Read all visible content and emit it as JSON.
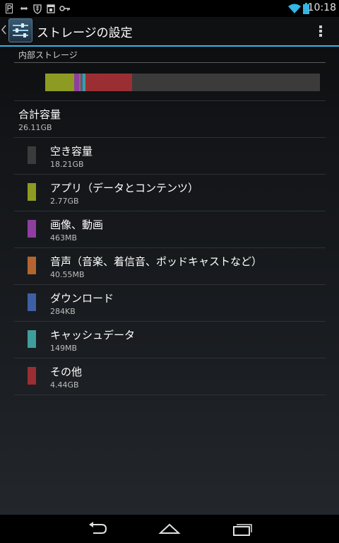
{
  "status_bar": {
    "time": "10:18",
    "left_icons": [
      "parking-icon",
      "usb-icon",
      "shield-icon",
      "calendar-icon",
      "key-icon"
    ],
    "right_icons": [
      "wifi-icon",
      "battery-icon"
    ]
  },
  "action_bar": {
    "title": "ストレージの設定",
    "icons": [
      "up-caret-icon",
      "settings-sliders-icon",
      "overflow-menu-icon"
    ]
  },
  "storage": {
    "section_header": "内部ストレージ",
    "total_label": "合計容量",
    "total_value": "26.11GB",
    "usage_bar_fractions": [
      {
        "category": "アプリ（データとコンテンツ）",
        "fraction": 0.106,
        "color": "#8e9b22"
      },
      {
        "category": "画像、動画",
        "fraction": 0.018,
        "color": "#8e3f9e"
      },
      {
        "category": "音声（音楽、着信音、ポッドキャストなど）",
        "fraction": 0.005,
        "color": "#b56430"
      },
      {
        "category": "ダウンロード",
        "fraction": 0.008,
        "color": "#3f5fa5"
      },
      {
        "category": "キャッシュデータ",
        "fraction": 0.01,
        "color": "#3f9e9c"
      },
      {
        "category": "その他",
        "fraction": 0.17,
        "color": "#9b2e33"
      }
    ],
    "bar_background_color": "#3b3b3b",
    "items": [
      {
        "label": "空き容量",
        "value": "18.21GB",
        "color": "#3b3b3b"
      },
      {
        "label": "アプリ（データとコンテンツ）",
        "value": "2.77GB",
        "color": "#8e9b22"
      },
      {
        "label": "画像、動画",
        "value": "463MB",
        "color": "#8e3f9e"
      },
      {
        "label": "音声（音楽、着信音、ポッドキャストなど）",
        "value": "40.55MB",
        "color": "#b56430"
      },
      {
        "label": "ダウンロード",
        "value": "284KB",
        "color": "#3f5fa5"
      },
      {
        "label": "キャッシュデータ",
        "value": "149MB",
        "color": "#3f9e9c"
      },
      {
        "label": "その他",
        "value": "4.44GB",
        "color": "#9b2e33"
      }
    ]
  },
  "nav_bar": {
    "icons": [
      "back-icon",
      "home-icon",
      "recent-apps-icon"
    ]
  },
  "accent_color": "#33b5e5"
}
